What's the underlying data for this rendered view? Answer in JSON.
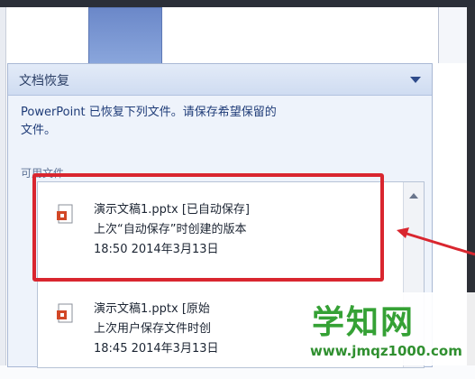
{
  "pane": {
    "title": "文档恢复",
    "description_line1": "PowerPoint 已恢复下列文件。请保存希望保留的",
    "description_line2": "文件。",
    "section_label": "可用文件"
  },
  "files": [
    {
      "name_status": "演示文稿1.pptx  [已自动保存]",
      "detail": "上次“自动保存”时创建的版本",
      "timestamp": "18:50 2014年3月13日"
    },
    {
      "name_status": "演示文稿1.pptx  [原始",
      "detail": "上次用户保存文件时创",
      "timestamp": "18:45 2014年3月13日"
    }
  ],
  "watermark": {
    "brand": "学知网",
    "url": "www.jmqz1000.com"
  },
  "colors": {
    "highlight": "#d9262f",
    "watermark": "#35a135",
    "pane_text": "#1f3c78"
  }
}
